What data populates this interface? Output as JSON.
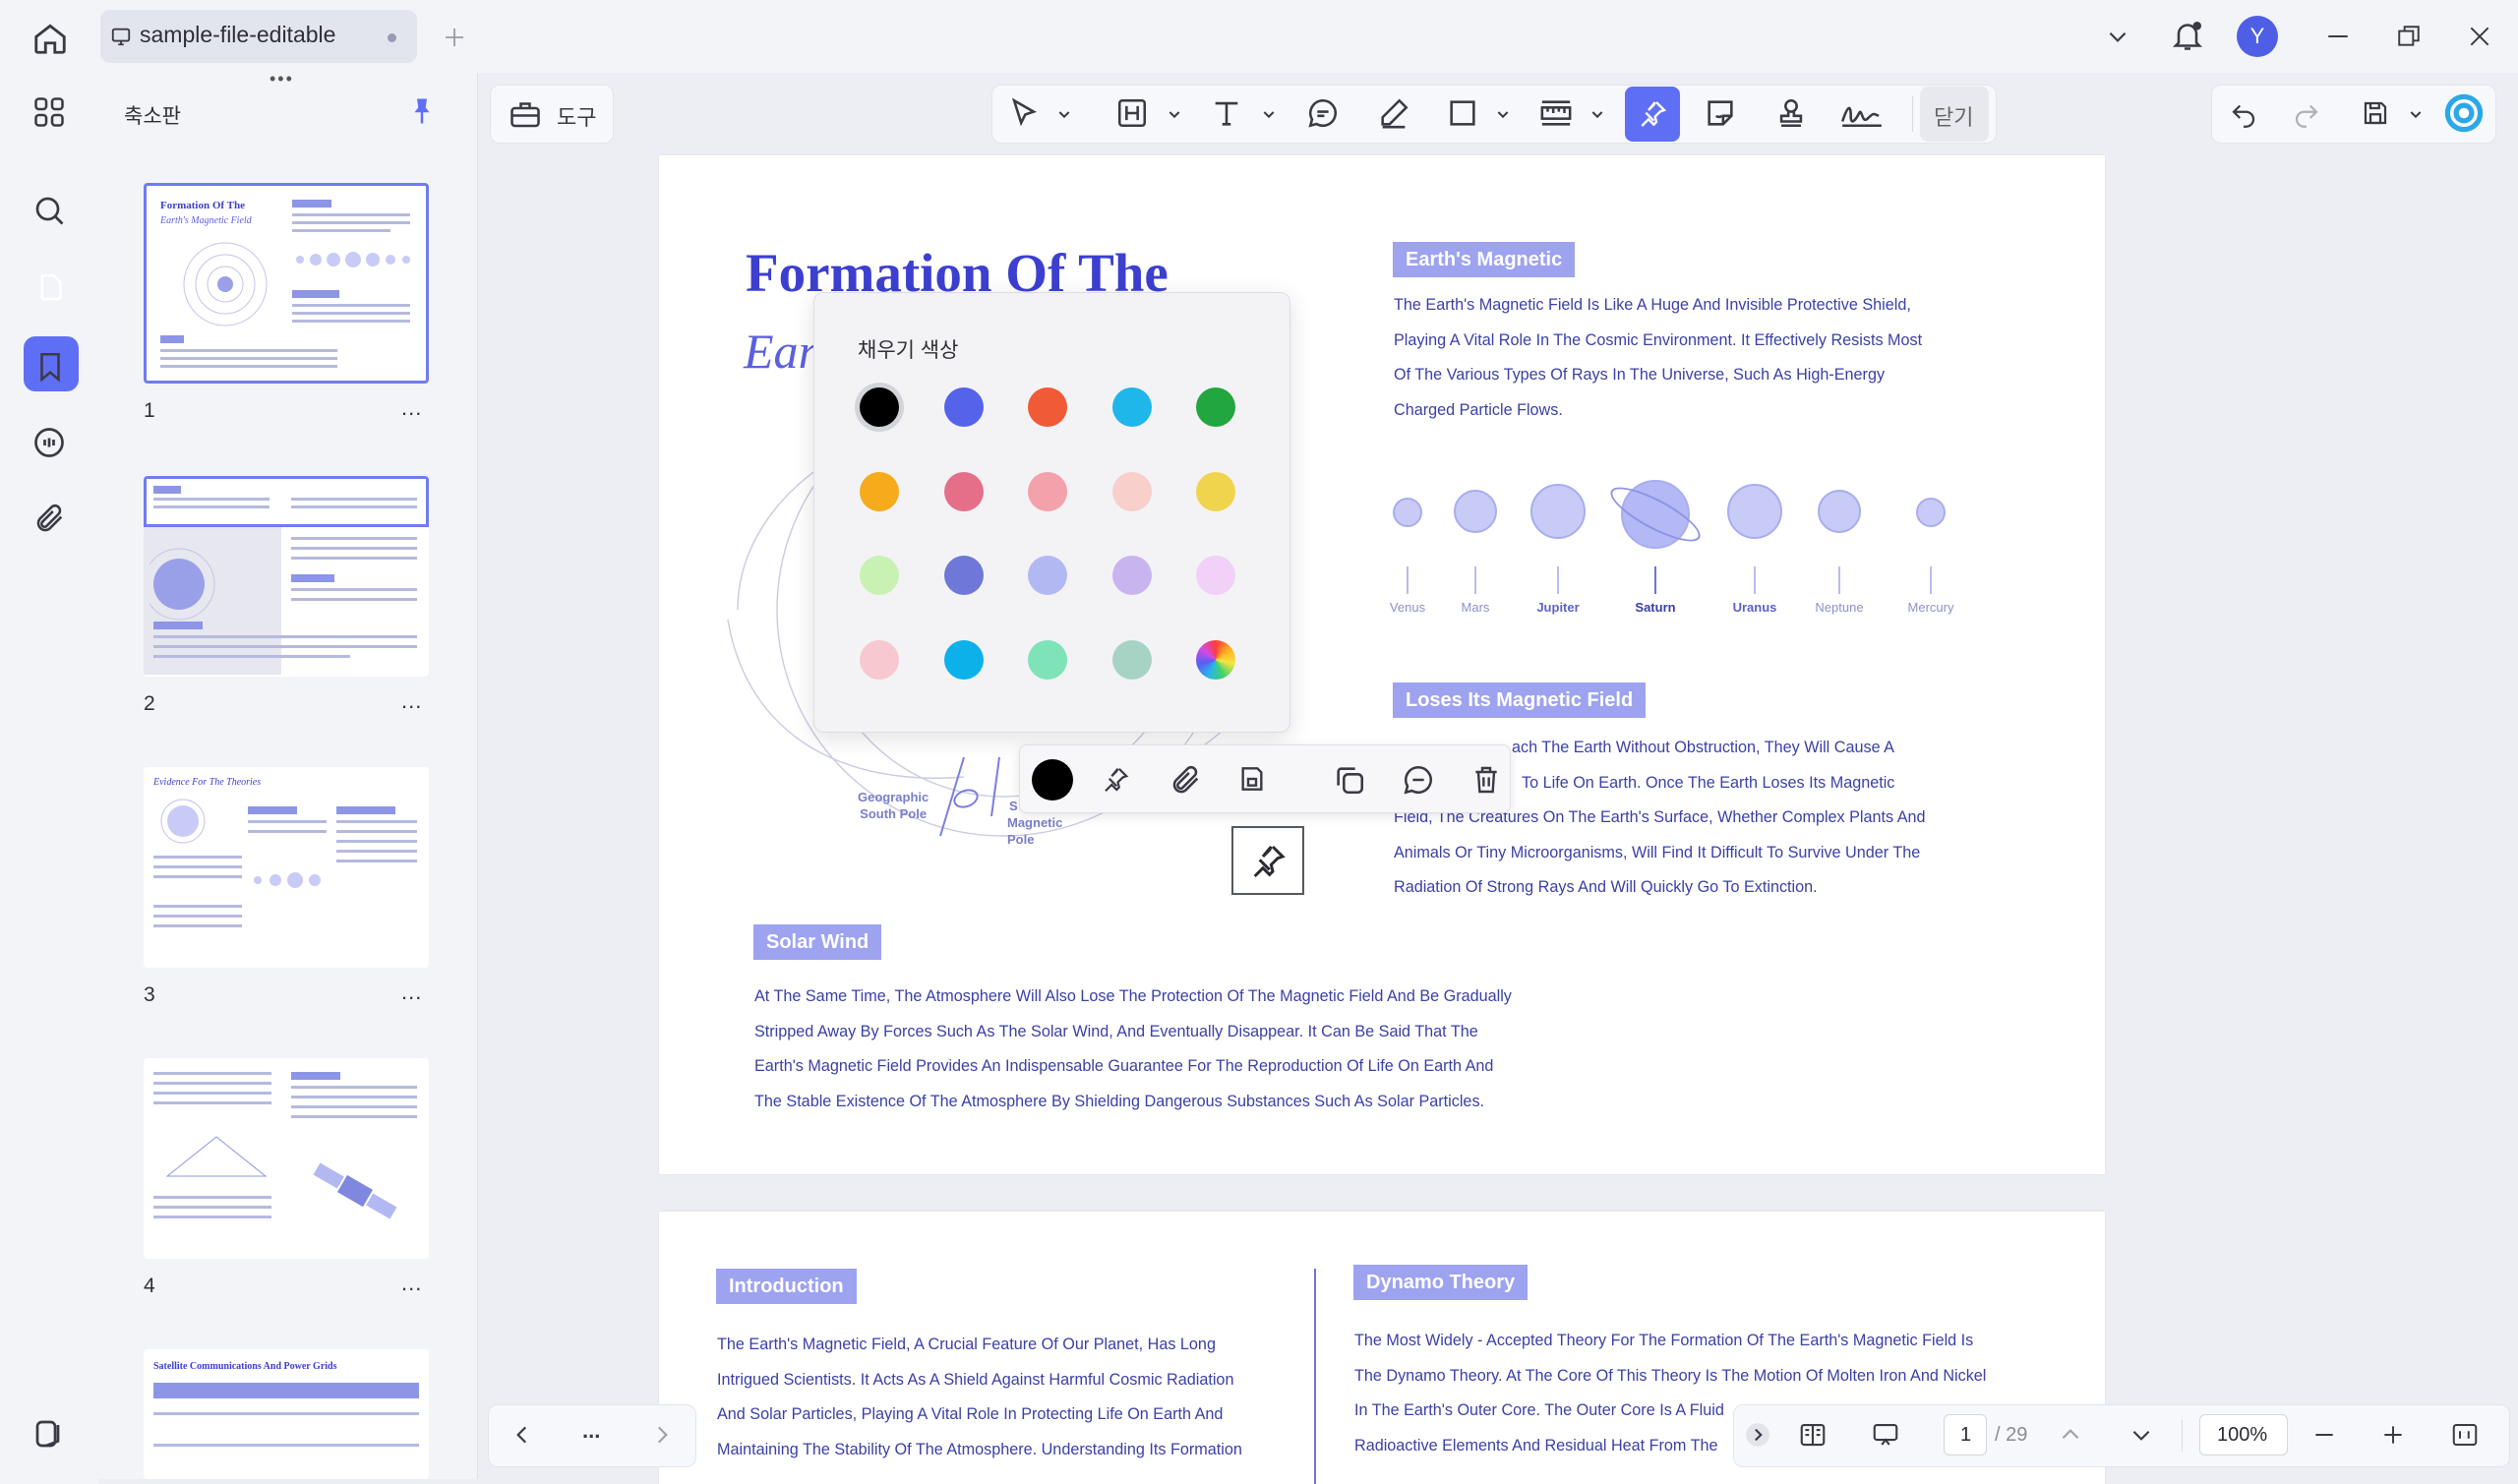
{
  "app": {
    "tab_title": "sample-file-editable",
    "avatar_letter": "Y",
    "accent": "#5f6ff5"
  },
  "panel": {
    "title": "축소판",
    "thumbnails": [
      {
        "number": "1",
        "title": "Formation Of The",
        "subtitle": "Earth's Magnetic Field",
        "selected": true
      },
      {
        "number": "2",
        "selected": false
      },
      {
        "number": "3",
        "title": "Evidence For The Theories",
        "selected": false
      },
      {
        "number": "4",
        "selected": false
      },
      {
        "number": "",
        "title": "Satellite Communications And Power Grids",
        "selected": false
      }
    ],
    "more_label": "..."
  },
  "toolbar": {
    "tools_label": "도구",
    "close_label": "닫기"
  },
  "page1": {
    "title_line1": "Formation Of The",
    "title_line2": "Ear",
    "section1": {
      "heading": "Earth's Magnetic",
      "lines": [
        "The Earth's Magnetic Field Is Like A Huge And Invisible Protective Shield,",
        "Playing A Vital Role In The Cosmic Environment. It Effectively Resists Most",
        "Of The Various Types Of Rays In The Universe, Such As High-Energy",
        "Charged Particle Flows."
      ]
    },
    "planets": [
      "Venus",
      "Mars",
      "Jupiter",
      "Saturn",
      "Uranus",
      "Neptune",
      "Mercury"
    ],
    "section2": {
      "heading": "Loses Its Magnetic Field",
      "lines": [
        "ach The Earth Without Obstruction, They Will Cause A",
        "To Life On Earth. Once The Earth Loses Its Magnetic",
        "Field, The Creatures On The Earth's Surface, Whether Complex Plants And",
        "Animals Or Tiny Microorganisms, Will Find It Difficult To Survive Under The",
        "Radiation Of Strong Rays And Will Quickly Go To Extinction."
      ]
    },
    "diagram_labels": {
      "geo_south": "Geographic\nSouth Pole",
      "mag_pole": "Magnetic\nPole",
      "mag_s": "S"
    },
    "section3": {
      "heading": "Solar Wind",
      "lines": [
        "At The Same Time, The Atmosphere Will Also Lose The Protection Of The Magnetic Field And Be Gradually",
        "Stripped Away By Forces Such As The Solar Wind, And Eventually Disappear. It Can Be Said That The",
        "Earth's Magnetic Field Provides An Indispensable Guarantee For The Reproduction Of Life On Earth And",
        "The Stable Existence Of The Atmosphere By Shielding Dangerous Substances Such As Solar Particles."
      ]
    }
  },
  "page2": {
    "intro": {
      "heading": "Introduction",
      "lines": [
        "The Earth's Magnetic Field, A Crucial Feature Of Our Planet, Has Long",
        "Intrigued Scientists. It Acts As A Shield Against Harmful Cosmic Radiation",
        "And Solar Particles, Playing A Vital Role In Protecting Life On Earth And",
        "Maintaining The Stability Of The Atmosphere. Understanding Its Formation"
      ]
    },
    "dynamo": {
      "heading": "Dynamo Theory",
      "lines": [
        "The Most Widely - Accepted Theory For The Formation Of The Earth's Magnetic Field Is",
        "The Dynamo Theory. At The Core Of This Theory Is The Motion Of Molten Iron And Nickel",
        "In The Earth's Outer Core. The Outer Core Is A Fluid",
        "Radioactive Elements And Residual Heat From The"
      ]
    }
  },
  "fill_popup": {
    "title": "채우기 색상",
    "colors": [
      "#000000",
      "#5463ea",
      "#f05a36",
      "#1fb6ea",
      "#22a63f",
      "#f6ab1c",
      "#e56f89",
      "#f3a1ab",
      "#f8cfcb",
      "#f1d44e",
      "#c9f1b3",
      "#6f78d8",
      "#b2b9f2",
      "#c8b4ee",
      "#f1d1f7",
      "#f8c8d0",
      "#0cb1ea",
      "#7fe3b9",
      "#a6d3c4",
      "rainbow"
    ],
    "selected_index": 0
  },
  "mini_toolbar": {
    "current_color": "#000000"
  },
  "bottom": {
    "more_label": "...",
    "page_current": "1",
    "page_total": "/ 29",
    "zoom": "100%"
  }
}
